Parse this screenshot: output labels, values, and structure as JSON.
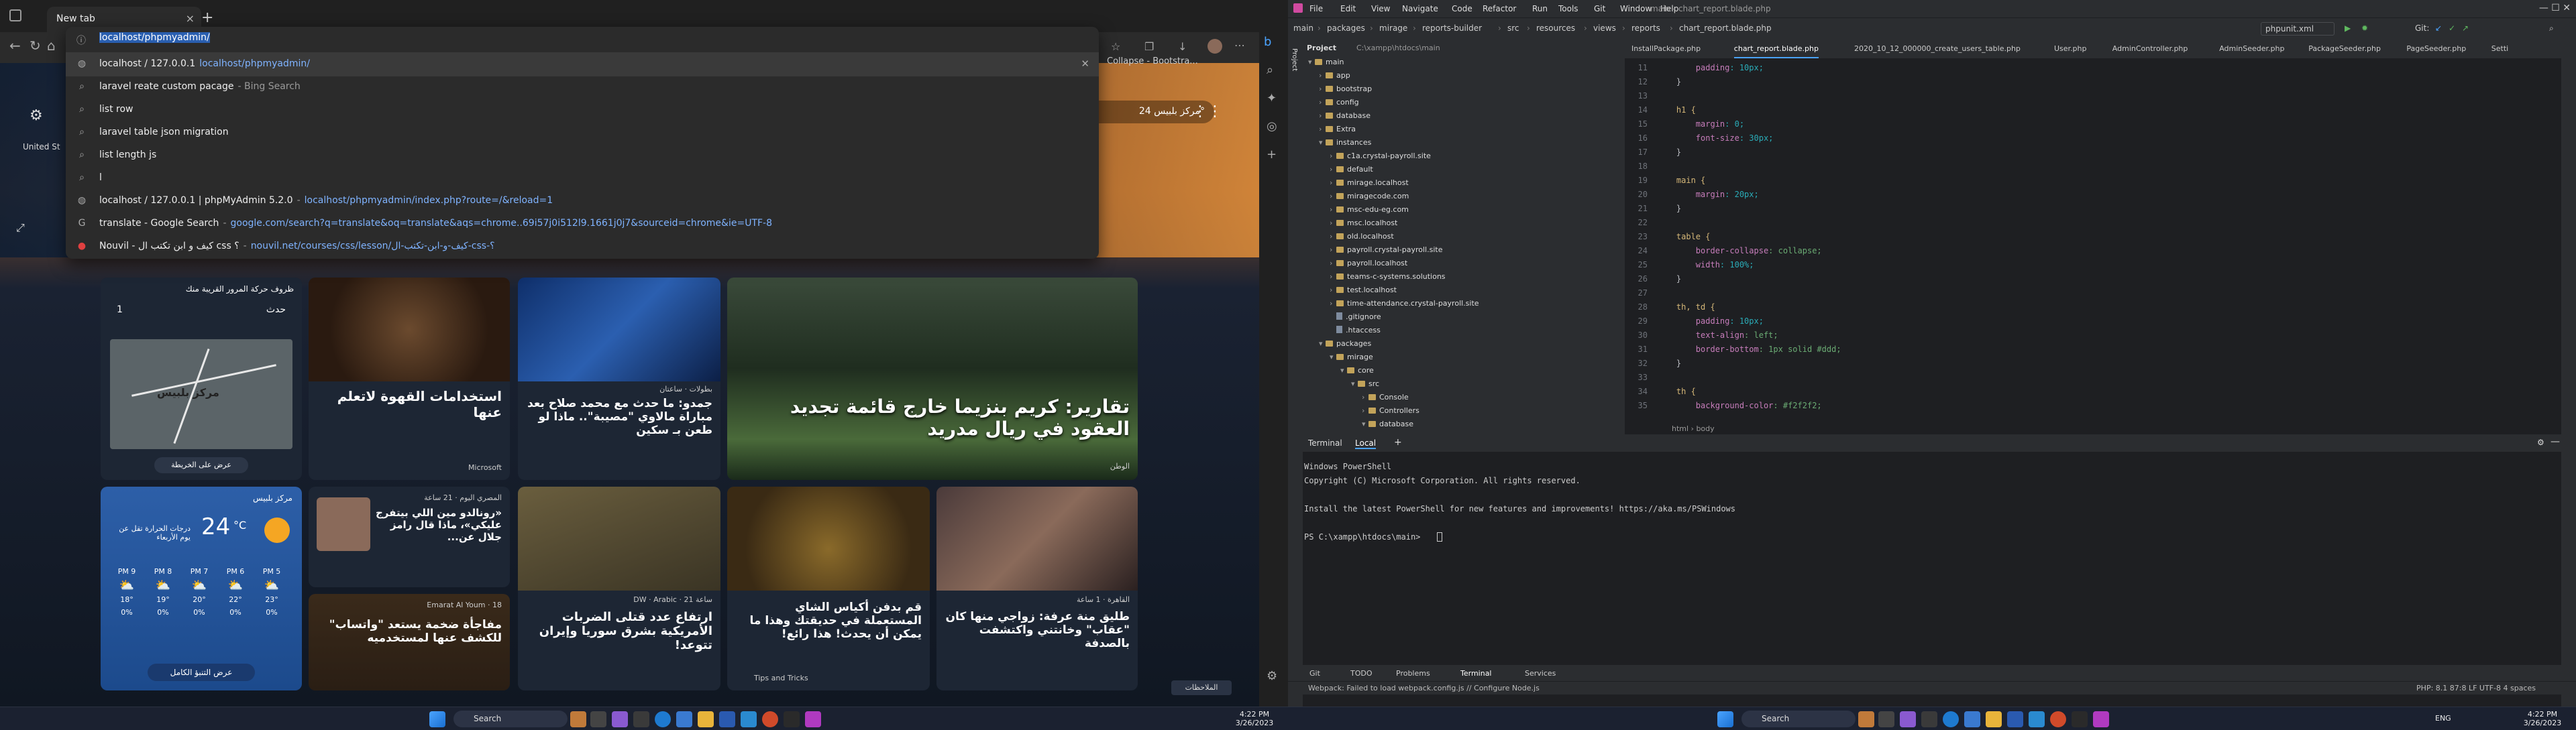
{
  "browser": {
    "tab_title": "New tab",
    "new_tab_glyph": "+",
    "omnibox_text": "localhost/phpmyadmin/",
    "suggestions": [
      {
        "icon": "globe-icon",
        "title": "localhost / 127.0.0.1",
        "url": "localhost/phpmyadmin/",
        "sub": ""
      },
      {
        "icon": "search-icon",
        "title": "laravel reate custom pacage",
        "url": "",
        "sub": "- Bing Search"
      },
      {
        "icon": "search-icon",
        "title": "list row",
        "url": "",
        "sub": ""
      },
      {
        "icon": "search-icon",
        "title": "laravel table json migration",
        "url": "",
        "sub": ""
      },
      {
        "icon": "search-icon",
        "title": "list length js",
        "url": "",
        "sub": ""
      },
      {
        "icon": "search-icon",
        "title": "l",
        "url": "",
        "sub": ""
      },
      {
        "icon": "globe-icon",
        "title": "localhost / 127.0.0.1 | phpMyAdmin 5.2.0",
        "url": "localhost/phpmyadmin/index.php?route=/&reload=1",
        "sub": "-"
      },
      {
        "icon": "google-icon",
        "title": "translate - Google Search",
        "url": "google.com/search?q=translate&oq=translate&aqs=chrome..69i57j0i512l9.1661j0j7&sourceid=chrome&ie=UTF-8",
        "sub": "-"
      },
      {
        "icon": "red-circle-icon",
        "title": "Nouvil - كيف و ابن تكتب ال css ؟",
        "url": "nouvil.net/courses/css/lesson/كيف-و-ابن-تكتب-ال-css-؟",
        "sub": "-"
      }
    ],
    "bookmark_text": "Collapse - Bootstra...",
    "region_text": "United St",
    "weather_pill": "مركز بلبيس  24°",
    "filter_text": "ال",
    "feedback_text": "الملاحظات"
  },
  "feed": {
    "traffic_title": "ظروف حركة المرور القريبة منك",
    "traffic_count_label": "حدث",
    "traffic_count": "1",
    "map_label": "مركز بلبيس",
    "map_button": "عرض على الخريطة",
    "weather_location": "مركز بلبيس",
    "weather_temp": "24",
    "weather_unit": "°C",
    "weather_desc": "درجات الحرارة تقل عن يوم الأربعاء",
    "forecast": [
      {
        "time": "PM 9",
        "temp": "18°",
        "rain": "0%"
      },
      {
        "time": "PM 8",
        "temp": "19°",
        "rain": "0%"
      },
      {
        "time": "PM 7",
        "temp": "20°",
        "rain": "0%"
      },
      {
        "time": "PM 6",
        "temp": "22°",
        "rain": "0%"
      },
      {
        "time": "PM 5",
        "temp": "23°",
        "rain": "0%"
      }
    ],
    "weather_button": "عرض التنبؤ الكامل",
    "cards": [
      {
        "title": "تقارير: كريم بنزيما خارج قائمة تجديد العقود في ريال مدريد",
        "source": "الوطن"
      },
      {
        "title": "جمدو: ما حدث مع محمد صلاح بعد مباراة مالاوي \"مصيبة\".. ماذا لو طعن بـ سكين",
        "source": "بطولات · ساعتان"
      },
      {
        "title": "استخدامات القهوة لاتعلم عنها",
        "source": "Microsoft"
      },
      {
        "title": "طليق منة عرفة: زواجي منها كان \"عقاب\" وخانتني واكتشفت بالصدفة",
        "source": "القاهرة · 1 ساعة"
      },
      {
        "title": "قم بدفن أكياس الشاي المستعملة في حديقتك وهذا ما يمكن أن يحدث! هذا رائع!",
        "source": "Tips and Tricks"
      },
      {
        "title": "ارتفاع عدد قتلى الضربات الأمريكية بشرق سوريا وإيران تتوعد!",
        "source": "DW · Arabic · 21 ساعة"
      },
      {
        "title": "«رونالدو مين اللي بيتفرج عليكي»، ماذا قال رامز جلال عن...",
        "source": "المصري اليوم · 21 ساعة"
      },
      {
        "title": "مفاجأة ضخمة يستعد \"واتساب\" للكشف عنها لمستخدميه",
        "source": "Emarat Al Youm · 18"
      }
    ]
  },
  "taskbar": {
    "search_label": "Search",
    "time": "4:22 PM",
    "date": "3/26/2023",
    "lang": "ENG"
  },
  "ide": {
    "menu": [
      "File",
      "Edit",
      "View",
      "Navigate",
      "Code",
      "Refactor",
      "Run",
      "Tools",
      "Git",
      "Window",
      "Help"
    ],
    "window_title": "main - chart_report.blade.php",
    "breadcrumbs": [
      "main",
      "packages",
      "mirage",
      "reports-builder",
      "src",
      "resources",
      "views",
      "reports",
      "chart_report.blade.php"
    ],
    "run_config": "phpunit.xml",
    "git_label": "Git:",
    "project_label": "Project",
    "project_path": "C:\\xampp\\htdocs\\main",
    "tree": [
      {
        "d": 0,
        "t": "folder",
        "n": "main",
        "o": true
      },
      {
        "d": 1,
        "t": "folder",
        "n": "app",
        "o": false
      },
      {
        "d": 1,
        "t": "folder",
        "n": "bootstrap",
        "o": false
      },
      {
        "d": 1,
        "t": "folder",
        "n": "config",
        "o": false
      },
      {
        "d": 1,
        "t": "folder",
        "n": "database",
        "o": false
      },
      {
        "d": 1,
        "t": "folder",
        "n": "Extra",
        "o": false
      },
      {
        "d": 1,
        "t": "folder",
        "n": "instances",
        "o": true
      },
      {
        "d": 2,
        "t": "folder",
        "n": "c1a.crystal-payroll.site",
        "o": false
      },
      {
        "d": 2,
        "t": "folder",
        "n": "default",
        "o": false
      },
      {
        "d": 2,
        "t": "folder",
        "n": "mirage.localhost",
        "o": false
      },
      {
        "d": 2,
        "t": "folder",
        "n": "miragecode.com",
        "o": false
      },
      {
        "d": 2,
        "t": "folder",
        "n": "msc-edu-eg.com",
        "o": false
      },
      {
        "d": 2,
        "t": "folder",
        "n": "msc.localhost",
        "o": false
      },
      {
        "d": 2,
        "t": "folder",
        "n": "old.localhost",
        "o": false
      },
      {
        "d": 2,
        "t": "folder",
        "n": "payroll.crystal-payroll.site",
        "o": false
      },
      {
        "d": 2,
        "t": "folder",
        "n": "payroll.localhost",
        "o": false
      },
      {
        "d": 2,
        "t": "folder",
        "n": "teams-c-systems.solutions",
        "o": false
      },
      {
        "d": 2,
        "t": "folder",
        "n": "test.localhost",
        "o": false
      },
      {
        "d": 2,
        "t": "folder",
        "n": "time-attendance.crystal-payroll.site",
        "o": false
      },
      {
        "d": 2,
        "t": "file",
        "n": ".gitignore",
        "o": false
      },
      {
        "d": 2,
        "t": "file",
        "n": ".htaccess",
        "o": false
      },
      {
        "d": 1,
        "t": "folder",
        "n": "packages",
        "o": true
      },
      {
        "d": 2,
        "t": "folder",
        "n": "mirage",
        "o": true
      },
      {
        "d": 3,
        "t": "folder",
        "n": "core",
        "o": true
      },
      {
        "d": 4,
        "t": "folder",
        "n": "src",
        "o": true
      },
      {
        "d": 5,
        "t": "folder",
        "n": "Console",
        "o": false
      },
      {
        "d": 5,
        "t": "folder",
        "n": "Controllers",
        "o": false
      },
      {
        "d": 5,
        "t": "folder",
        "n": "database",
        "o": true
      }
    ],
    "editor_tabs": [
      "InstallPackage.php",
      "chart_report.blade.php",
      "2020_10_12_000000_create_users_table.php",
      "User.php",
      "AdminController.php",
      "AdminSeeder.php",
      "PackageSeeder.php",
      "PageSeeder.php",
      "Setti"
    ],
    "code_lines": [
      {
        "n": "11",
        "s": [
          [
            "        ",
            "plain"
          ],
          [
            "padding",
            "prop"
          ],
          [
            ": 10px;",
            "num"
          ]
        ]
      },
      {
        "n": "12",
        "s": [
          [
            "    }",
            "plain"
          ]
        ]
      },
      {
        "n": "13",
        "s": [
          [
            "",
            "plain"
          ]
        ]
      },
      {
        "n": "14",
        "s": [
          [
            "    h1 {",
            "sel"
          ]
        ]
      },
      {
        "n": "15",
        "s": [
          [
            "        ",
            "plain"
          ],
          [
            "margin",
            "prop"
          ],
          [
            ": 0;",
            "num"
          ]
        ]
      },
      {
        "n": "16",
        "s": [
          [
            "        ",
            "plain"
          ],
          [
            "font-size",
            "prop"
          ],
          [
            ": 30px;",
            "num"
          ]
        ]
      },
      {
        "n": "17",
        "s": [
          [
            "    }",
            "plain"
          ]
        ]
      },
      {
        "n": "18",
        "s": [
          [
            "",
            "plain"
          ]
        ]
      },
      {
        "n": "19",
        "s": [
          [
            "    main {",
            "sel"
          ]
        ]
      },
      {
        "n": "20",
        "s": [
          [
            "        ",
            "plain"
          ],
          [
            "margin",
            "prop"
          ],
          [
            ": 20px;",
            "num"
          ]
        ]
      },
      {
        "n": "21",
        "s": [
          [
            "    }",
            "plain"
          ]
        ]
      },
      {
        "n": "22",
        "s": [
          [
            "",
            "plain"
          ]
        ]
      },
      {
        "n": "23",
        "s": [
          [
            "    table {",
            "sel"
          ]
        ]
      },
      {
        "n": "24",
        "s": [
          [
            "        ",
            "plain"
          ],
          [
            "border-collapse",
            "prop"
          ],
          [
            ": collapse;",
            "val"
          ]
        ]
      },
      {
        "n": "25",
        "s": [
          [
            "        ",
            "plain"
          ],
          [
            "width",
            "prop"
          ],
          [
            ": 100%;",
            "num"
          ]
        ]
      },
      {
        "n": "26",
        "s": [
          [
            "    }",
            "plain"
          ]
        ]
      },
      {
        "n": "27",
        "s": [
          [
            "",
            "plain"
          ]
        ]
      },
      {
        "n": "28",
        "s": [
          [
            "    th, td {",
            "sel"
          ]
        ]
      },
      {
        "n": "29",
        "s": [
          [
            "        ",
            "plain"
          ],
          [
            "padding",
            "prop"
          ],
          [
            ": 10px;",
            "num"
          ]
        ]
      },
      {
        "n": "30",
        "s": [
          [
            "        ",
            "plain"
          ],
          [
            "text-align",
            "prop"
          ],
          [
            ": left;",
            "val"
          ]
        ]
      },
      {
        "n": "31",
        "s": [
          [
            "        ",
            "plain"
          ],
          [
            "border-bottom",
            "prop"
          ],
          [
            ": 1px solid #ddd;",
            "val"
          ]
        ]
      },
      {
        "n": "32",
        "s": [
          [
            "    }",
            "plain"
          ]
        ]
      },
      {
        "n": "33",
        "s": [
          [
            "",
            "plain"
          ]
        ]
      },
      {
        "n": "34",
        "s": [
          [
            "    th {",
            "sel"
          ]
        ]
      },
      {
        "n": "35",
        "s": [
          [
            "        ",
            "plain"
          ],
          [
            "background-color",
            "prop"
          ],
          [
            ": #f2f2f2;",
            "val"
          ]
        ]
      }
    ],
    "editor_crumb": "html  ›  body",
    "terminal_tab": "Terminal",
    "terminal_local": "Local",
    "terminal_lines": [
      "Windows PowerShell",
      "Copyright (C) Microsoft Corporation. All rights reserved.",
      "",
      "Install the latest PowerShell for new features and improvements! https://aka.ms/PSWindows",
      "",
      "PS C:\\xampp\\htdocs\\main> "
    ],
    "bottom_tabs": [
      "Git",
      "TODO",
      "Problems",
      "Terminal",
      "Services"
    ],
    "status_left": "Webpack: Failed to load webpack.config.js // Configure Node.js",
    "status_right": "PHP: 8.1   87:8   LF   UTF-8   4 spaces"
  }
}
